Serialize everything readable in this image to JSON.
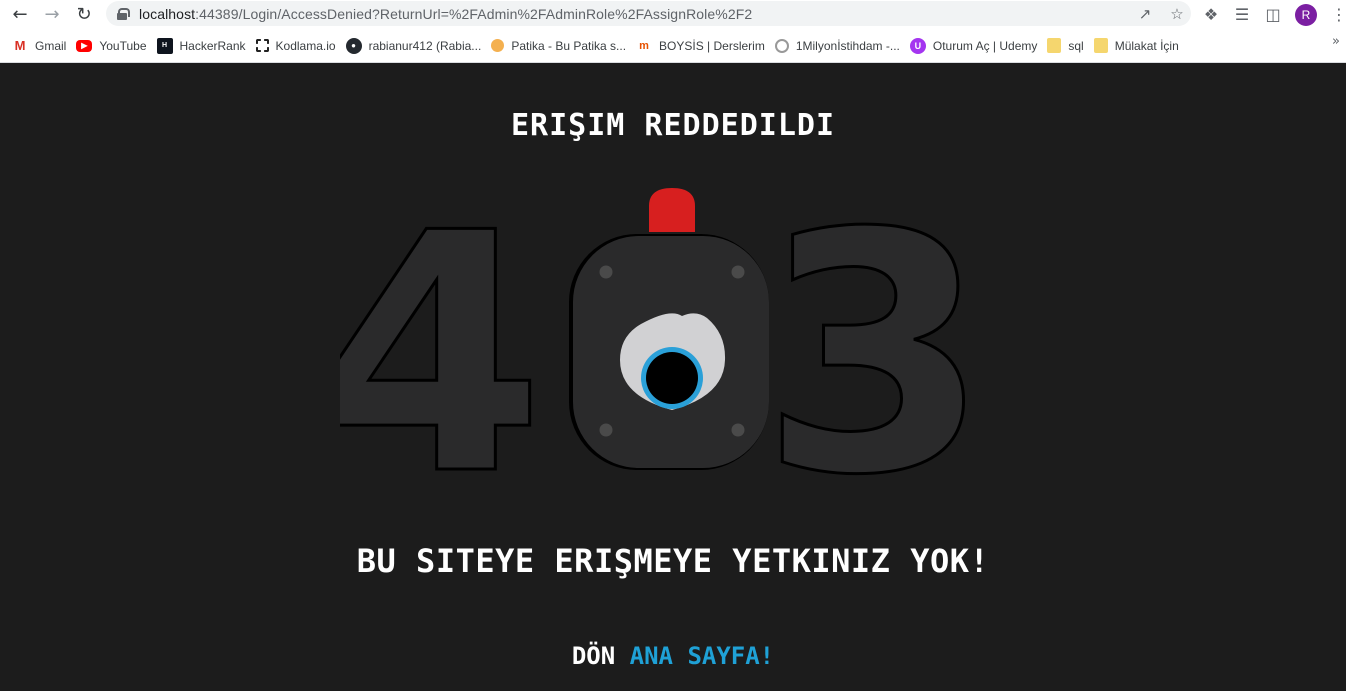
{
  "browser": {
    "url_host": "localhost",
    "url_rest": ":44389/Login/AccessDenied?ReturnUrl=%2FAdmin%2FAdminRole%2FAssignRole%2F2",
    "profile_initial": "R",
    "bookmarks": [
      {
        "label": "Gmail",
        "icon": "gmail-icon"
      },
      {
        "label": "YouTube",
        "icon": "youtube-icon"
      },
      {
        "label": "HackerRank",
        "icon": "hackerrank-icon"
      },
      {
        "label": "Kodlama.io",
        "icon": "kodlama-icon"
      },
      {
        "label": "rabianur412 (Rabia...",
        "icon": "github-icon"
      },
      {
        "label": "Patika - Bu Patika s...",
        "icon": "patika-icon"
      },
      {
        "label": "BOYSİS | Derslerim",
        "icon": "boysis-icon"
      },
      {
        "label": "1Milyonİstihdam -...",
        "icon": "milyon-icon"
      },
      {
        "label": "Oturum Aç | Udemy",
        "icon": "udemy-icon"
      },
      {
        "label": "sql",
        "icon": "folder-icon"
      },
      {
        "label": "Mülakat İçin",
        "icon": "folder-icon"
      }
    ]
  },
  "page": {
    "title": "Erişim Reddedildi",
    "code_left": "4",
    "code_right": "3",
    "message": "Bu siteye erişmeye yetkiniz yok!",
    "return_lead": "Dön ",
    "return_link": "Ana Sayfa!"
  },
  "colors": {
    "background": "#1c1c1c",
    "digit": "#2a2a2b",
    "siren": "#d71f1f",
    "eye_ring": "#2aa0d8",
    "link": "#1fa1d6"
  }
}
